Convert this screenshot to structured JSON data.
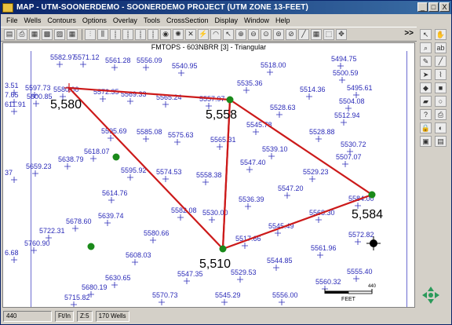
{
  "window": {
    "title": "MAP - UTM-SOONERDEMO - SOONERDEMO PROJECT (UTM ZONE 13-FEET)",
    "controls": [
      "_",
      "□",
      "X"
    ]
  },
  "menu": [
    "File",
    "Wells",
    "Contours",
    "Options",
    "Overlay",
    "Tools",
    "CrossSection",
    "Display",
    "Window",
    "Help"
  ],
  "toolbar": {
    "more_label": ">>"
  },
  "map": {
    "header": "FMTOPS - 603NBRR [3] - Triangular",
    "colors": {
      "value_text": "#2b2bb8",
      "triangle": "#cc1a1a",
      "well_green": "#1a8a1a",
      "well_black": "#000000"
    },
    "values": [
      {
        "text": "5582.97"
      },
      {
        "text": "5571.12"
      },
      {
        "text": "5561.28"
      },
      {
        "text": "5556.09"
      },
      {
        "text": "5540.95"
      },
      {
        "text": "5518.00"
      },
      {
        "text": "5494.75"
      },
      {
        "text": "5500.59"
      },
      {
        "text": "3.51"
      },
      {
        "text": "5597.73"
      },
      {
        "text": "5580.00"
      },
      {
        "text": "7.65"
      },
      {
        "text": "5600.85"
      },
      {
        "text": "611.91"
      },
      {
        "text": "5572.35"
      },
      {
        "text": "5569.33"
      },
      {
        "text": "5565.24"
      },
      {
        "text": "5557.97"
      },
      {
        "text": "5535.36"
      },
      {
        "text": "5514.36"
      },
      {
        "text": "5495.61"
      },
      {
        "text": "5504.08"
      },
      {
        "text": "5528.63"
      },
      {
        "text": "5512.94"
      },
      {
        "text": "5595.69"
      },
      {
        "text": "5585.08"
      },
      {
        "text": "5575.63"
      },
      {
        "text": "5565.31"
      },
      {
        "text": "5545.78"
      },
      {
        "text": "5528.88"
      },
      {
        "text": "5530.72"
      },
      {
        "text": "5539.10"
      },
      {
        "text": "5507.07"
      },
      {
        "text": "5618.07"
      },
      {
        "text": "5638.79"
      },
      {
        "text": "5659.23"
      },
      {
        "text": "37"
      },
      {
        "text": "5595.92"
      },
      {
        "text": "5574.53"
      },
      {
        "text": "5558.38"
      },
      {
        "text": "5547.40"
      },
      {
        "text": "5529.23"
      },
      {
        "text": "5547.20"
      },
      {
        "text": "5614.76"
      },
      {
        "text": "5536.39"
      },
      {
        "text": "5584.00"
      },
      {
        "text": "5639.74"
      },
      {
        "text": "5582.08"
      },
      {
        "text": "5530.00"
      },
      {
        "text": "5568.30"
      },
      {
        "text": "5678.60"
      },
      {
        "text": "5722.31"
      },
      {
        "text": "5580.66"
      },
      {
        "text": "5545.49"
      },
      {
        "text": "5760.90"
      },
      {
        "text": "5517.66"
      },
      {
        "text": "5572.82"
      },
      {
        "text": "6.68"
      },
      {
        "text": "5608.03"
      },
      {
        "text": "5561.96"
      },
      {
        "text": "5544.85"
      },
      {
        "text": "5529.53"
      },
      {
        "text": "5547.35"
      },
      {
        "text": "5630.65"
      },
      {
        "text": "5560.32"
      },
      {
        "text": "5555.40"
      },
      {
        "text": "5680.19"
      },
      {
        "text": "5715.82"
      },
      {
        "text": "5570.73"
      },
      {
        "text": "5545.29"
      },
      {
        "text": "5556.00"
      }
    ],
    "big_labels": [
      "5,580",
      "5,558",
      "5,584",
      "5,510"
    ],
    "scale_bar": {
      "value": "440",
      "unit": "FEET"
    }
  },
  "right_tools": [
    "arrow",
    "hand",
    "zoom",
    "abc",
    "pencil",
    "line",
    "arrow-right",
    "polyline",
    "marker",
    "square",
    "fill",
    "circle",
    "help",
    "printer",
    "lock",
    "palette",
    "open",
    "layers",
    "nav"
  ],
  "status": {
    "coord": "440",
    "unit": "Ft/In",
    "zoom": "Z:5",
    "wells": "170 Wells"
  }
}
